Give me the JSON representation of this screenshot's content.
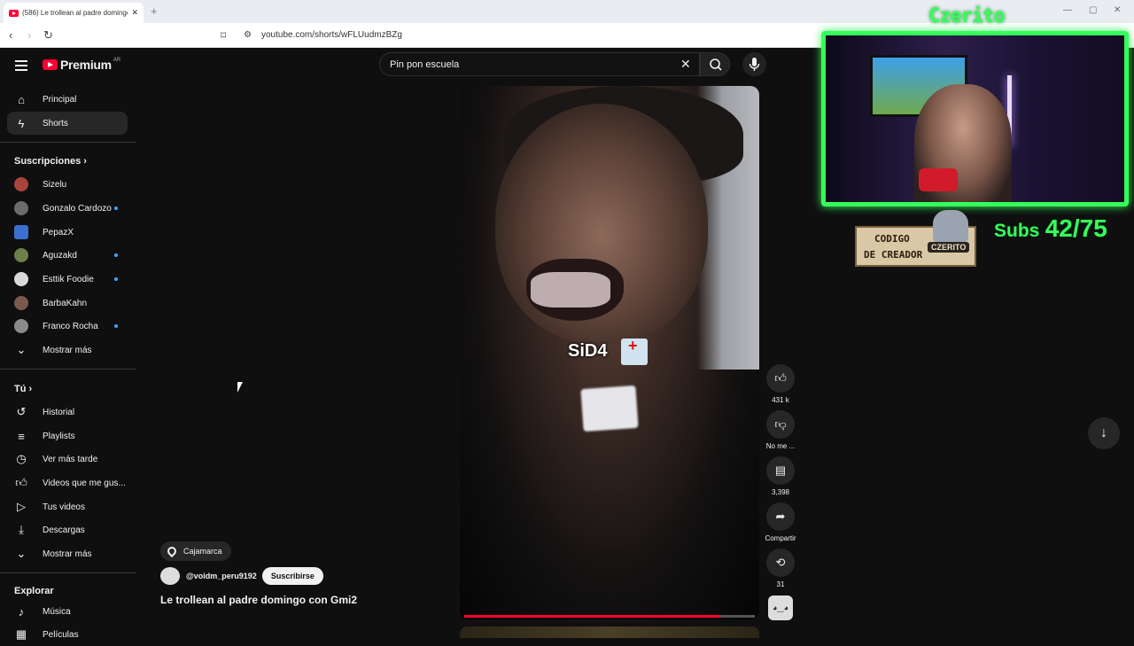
{
  "browser": {
    "tab_title": "(586) Le trollean al padre domingo",
    "url": "youtube.com/shorts/wFLUudmzBZg",
    "new_tab_glyph": "+"
  },
  "youtube": {
    "logo_text": "Premium",
    "country_code": "AR",
    "search_query": "Pin pon escuela",
    "sidebar": {
      "main": [
        {
          "label": "Principal",
          "icon": "home-icon"
        },
        {
          "label": "Shorts",
          "icon": "shorts-icon",
          "active": true
        }
      ],
      "subscriptions_header": "Suscripciones",
      "subscriptions": [
        {
          "label": "Sizelu",
          "color": "#a8443c",
          "dot": false
        },
        {
          "label": "Gonzalo Cardozo",
          "color": "#6b6b6b",
          "dot": true
        },
        {
          "label": "PepazX",
          "color": "#3b6fd1",
          "dot": false
        },
        {
          "label": "Aguzakd",
          "color": "#6f7f4a",
          "dot": true
        },
        {
          "label": "Esttik Foodie",
          "color": "#d9d9d9",
          "dot": true
        },
        {
          "label": "BarbaKahn",
          "color": "#7a5a4c",
          "dot": false
        },
        {
          "label": "Franco Rocha",
          "color": "#8a8a8a",
          "dot": true
        },
        {
          "label": "Mostrar más",
          "icon": "chevron-down-icon"
        }
      ],
      "you_header": "Tú",
      "you": [
        {
          "label": "Historial",
          "icon": "history-icon"
        },
        {
          "label": "Playlists",
          "icon": "playlists-icon"
        },
        {
          "label": "Ver más tarde",
          "icon": "clock-icon"
        },
        {
          "label": "Videos que me gus...",
          "icon": "thumbs-up-icon"
        },
        {
          "label": "Tus videos",
          "icon": "your-videos-icon"
        },
        {
          "label": "Descargas",
          "icon": "download-icon"
        },
        {
          "label": "Mostrar más",
          "icon": "chevron-down-icon"
        }
      ],
      "explore_header": "Explorar",
      "explore": [
        {
          "label": "Música",
          "icon": "music-icon"
        },
        {
          "label": "Películas",
          "icon": "film-icon"
        }
      ]
    },
    "short": {
      "caption": "SiD4",
      "location": "Cajamarca",
      "channel": "@voidm_peru9192",
      "subscribe_label": "Suscribirse",
      "title": "Le trollean al padre domingo con Gmi2",
      "progress": 0.88,
      "actions": {
        "likes": "431 k",
        "dislike_label": "No me ...",
        "comments": "3,398",
        "share_label": "Compartir",
        "remix_count": "31"
      }
    }
  },
  "overlay": {
    "streamer_name": "Czerito",
    "creator_code_line1": "CODIGO",
    "creator_code_line2": "DE CREADOR",
    "creator_badge": "CZERITO",
    "subs_label": "Subs",
    "subs_value": "42/75",
    "accent_color": "#35ff5a"
  }
}
